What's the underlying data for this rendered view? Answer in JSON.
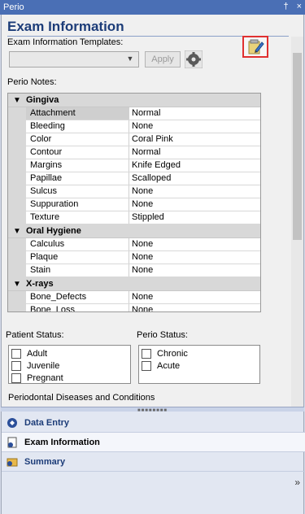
{
  "window": {
    "title": "Perio",
    "pin_glyph": "†",
    "close_glyph": "×"
  },
  "header": {
    "title": "Exam Information"
  },
  "templates": {
    "label": "Exam Information Templates:",
    "selected_value": "",
    "apply_label": "Apply"
  },
  "notes": {
    "label": "Perio Notes:"
  },
  "grid": {
    "categories": [
      {
        "name": "Gingiva",
        "rows": [
          {
            "k": "Attachment",
            "v": "Normal"
          },
          {
            "k": "Bleeding",
            "v": "None"
          },
          {
            "k": "Color",
            "v": "Coral Pink"
          },
          {
            "k": "Contour",
            "v": "Normal"
          },
          {
            "k": "Margins",
            "v": "Knife Edged"
          },
          {
            "k": "Papillae",
            "v": "Scalloped"
          },
          {
            "k": "Sulcus",
            "v": "None"
          },
          {
            "k": "Suppuration",
            "v": "None"
          },
          {
            "k": "Texture",
            "v": "Stippled"
          }
        ]
      },
      {
        "name": "Oral Hygiene",
        "rows": [
          {
            "k": "Calculus",
            "v": "None"
          },
          {
            "k": "Plaque",
            "v": "None"
          },
          {
            "k": "Stain",
            "v": "None"
          }
        ]
      },
      {
        "name": "X-rays",
        "rows": [
          {
            "k": "Bone_Defects",
            "v": "None"
          },
          {
            "k": "Bone_Loss",
            "v": "None"
          }
        ]
      }
    ]
  },
  "patient_status": {
    "label": "Patient Status:",
    "options": [
      "Adult",
      "Juvenile",
      "Pregnant"
    ]
  },
  "perio_status": {
    "label": "Perio Status:",
    "options": [
      "Chronic",
      "Acute"
    ]
  },
  "diseases": {
    "label": "Periodontal Diseases and Conditions"
  },
  "nav": {
    "items": [
      {
        "label": "Data Entry",
        "icon": "data-entry-icon"
      },
      {
        "label": "Exam Information",
        "icon": "exam-info-icon"
      },
      {
        "label": "Summary",
        "icon": "summary-icon"
      }
    ],
    "more_glyph": "»"
  },
  "colors": {
    "title_blue": "#1c3c78",
    "titlebar": "#4a6fb5",
    "highlight_red": "#e03030"
  }
}
